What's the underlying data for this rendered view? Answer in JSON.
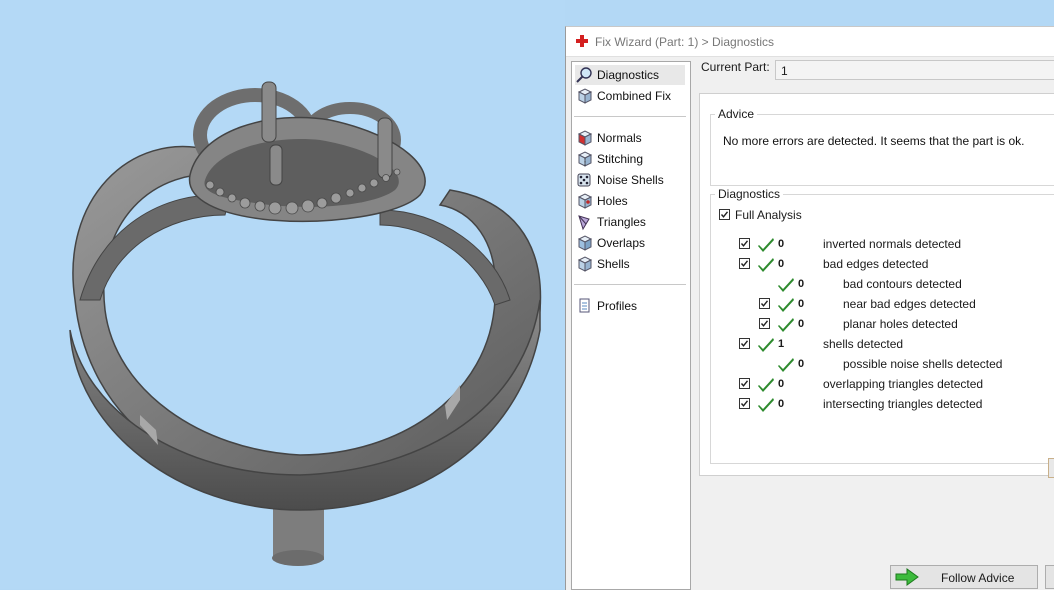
{
  "window": {
    "title": "Fix Wizard (Part: 1) > Diagnostics",
    "icon": "red-cross-icon"
  },
  "nav": {
    "items": [
      {
        "label": "Diagnostics",
        "icon": "magnifier-icon",
        "selected": true
      },
      {
        "label": "Combined Fix",
        "icon": "cube-icon"
      },
      {
        "label": "Normals",
        "icon": "cube-red-face-icon"
      },
      {
        "label": "Stitching",
        "icon": "cube-stitch-icon"
      },
      {
        "label": "Noise Shells",
        "icon": "dice-icon"
      },
      {
        "label": "Holes",
        "icon": "cube-hole-icon"
      },
      {
        "label": "Triangles",
        "icon": "triangles-icon"
      },
      {
        "label": "Overlaps",
        "icon": "overlap-icon"
      },
      {
        "label": "Shells",
        "icon": "shells-icon"
      },
      {
        "label": "Profiles",
        "icon": "document-icon"
      }
    ]
  },
  "current_part": {
    "label": "Current Part:",
    "value": "1"
  },
  "advice": {
    "title": "Advice",
    "text": "No more errors are detected. It seems that the part is ok."
  },
  "diagnostics": {
    "title": "Diagnostics",
    "full_analysis": {
      "label": "Full Analysis",
      "checked": true
    },
    "rows": [
      {
        "count": "0",
        "label": "inverted normals detected",
        "checked": true
      },
      {
        "count": "0",
        "label": "bad edges detected",
        "checked": true
      },
      {
        "count": "0",
        "label": "bad contours detected"
      },
      {
        "count": "0",
        "label": "near bad edges detected",
        "checked": true
      },
      {
        "count": "0",
        "label": "planar holes detected",
        "checked": true
      },
      {
        "count": "1",
        "label": "shells detected",
        "checked": true
      },
      {
        "count": "0",
        "label": "possible noise shells detected"
      },
      {
        "count": "0",
        "label": "overlapping triangles detected",
        "checked": true
      },
      {
        "count": "0",
        "label": "intersecting triangles detected",
        "checked": true
      }
    ]
  },
  "buttons": {
    "follow_advice": "Follow Advice"
  },
  "colors": {
    "viewport_bg": "#b4d9f6",
    "check_green": "#2e8b2e",
    "ring_gray": "#7a7a7a"
  }
}
